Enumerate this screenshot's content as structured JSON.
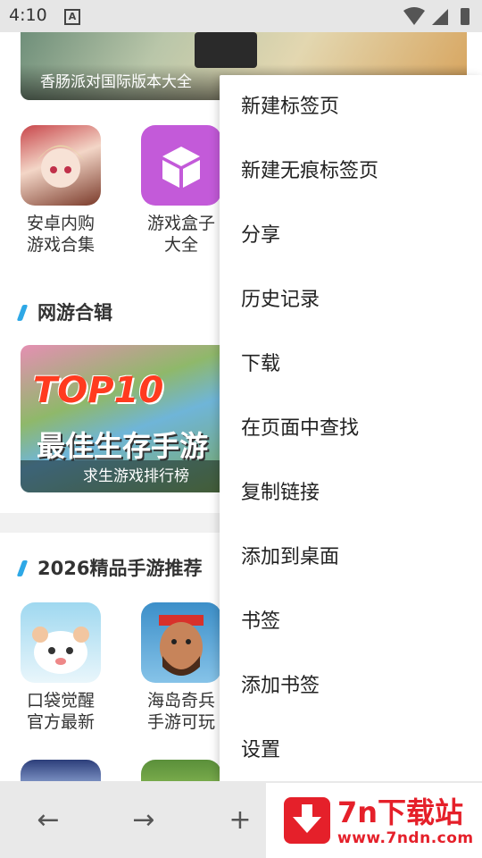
{
  "status": {
    "time": "4:10",
    "notification_icon": "a-icon"
  },
  "content": {
    "top_banner_caption": "香肠派对国际版本大全",
    "apps_row1": [
      {
        "label_line1": "安卓内购",
        "label_line2": "游戏合集",
        "icon": "anime-girl-icon"
      },
      {
        "label_line1": "游戏盒子",
        "label_line2": "大全",
        "icon": "cube-icon"
      }
    ],
    "section1_title": "网游合辑",
    "big_banner": {
      "title1": "TOP10",
      "title2": "最佳生存手游",
      "caption": "求生游戏排行榜"
    },
    "section2_title": "2026精品手游推荐",
    "apps_row2": [
      {
        "label_line1": "口袋觉醒",
        "label_line2": "官方最新",
        "icon": "panda-icon"
      },
      {
        "label_line1": "海岛奇兵",
        "label_line2": "手游可玩",
        "icon": "soldier-icon"
      }
    ]
  },
  "menu": {
    "items": [
      "新建标签页",
      "新建无痕标签页",
      "分享",
      "历史记录",
      "下载",
      "在页面中查找",
      "复制链接",
      "添加到桌面",
      "书签",
      "添加书签",
      "设置"
    ]
  },
  "bottom": {
    "back": "←",
    "forward": "→",
    "add": "+"
  },
  "brand": {
    "name": "7n下载站",
    "url": "www.7ndn.com"
  },
  "colors": {
    "accent": "#2ea8e6",
    "brand_red": "#e5202a"
  }
}
